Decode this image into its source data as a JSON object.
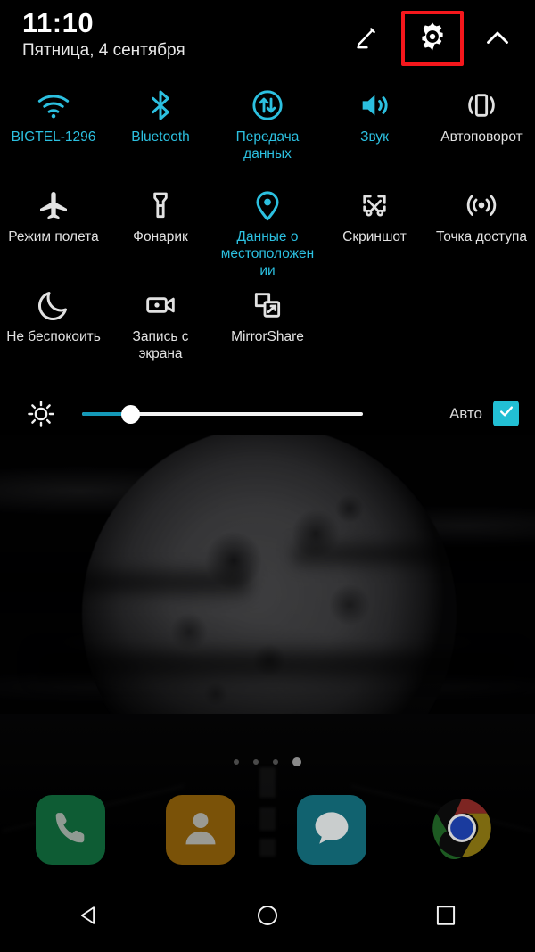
{
  "statusbar": {
    "time": "11:10",
    "date": "Пятница, 4 сентября"
  },
  "header": {
    "edit_icon": "pencil-icon",
    "settings_icon": "gear-icon",
    "collapse_icon": "chevron-up-icon",
    "highlight_color": "#f5171c",
    "highlight_target": "settings-button"
  },
  "colors": {
    "active": "#2cc0e0",
    "inactive": "#e2e2e2",
    "checkbox": "#22bfd4",
    "slider_fill": "#1499b8",
    "highlight": "#f5171c"
  },
  "tiles": [
    [
      {
        "label": "BIGTEL-1296",
        "icon": "wifi-icon",
        "state": "on"
      },
      {
        "label": "Bluetooth",
        "icon": "bluetooth-icon",
        "state": "on"
      },
      {
        "label": "Передача данных",
        "icon": "mobile-data-icon",
        "state": "on"
      },
      {
        "label": "Звук",
        "icon": "sound-icon",
        "state": "on"
      },
      {
        "label": "Автоповорот",
        "icon": "auto-rotate-icon",
        "state": "off"
      }
    ],
    [
      {
        "label": "Режим полета",
        "icon": "airplane-icon",
        "state": "off"
      },
      {
        "label": "Фонарик",
        "icon": "flashlight-icon",
        "state": "off"
      },
      {
        "label": "Данные о местоположении",
        "icon": "location-pin-icon",
        "state": "on"
      },
      {
        "label": "Скриншот",
        "icon": "screenshot-icon",
        "state": "off"
      },
      {
        "label": "Точка доступа",
        "icon": "hotspot-icon",
        "state": "off"
      }
    ],
    [
      {
        "label": "Не беспокоить",
        "icon": "moon-icon",
        "state": "off"
      },
      {
        "label": "Запись с экрана",
        "icon": "screen-record-icon",
        "state": "off"
      },
      {
        "label": "MirrorShare",
        "icon": "mirrorshare-icon",
        "state": "off"
      }
    ]
  ],
  "brightness": {
    "icon": "brightness-icon",
    "value_percent": 18,
    "auto_label": "Авто",
    "auto_checked": true,
    "check_icon": "check-icon"
  },
  "home": {
    "page_dots": 4,
    "active_dot_index": 3,
    "dock": [
      {
        "name": "Телефон",
        "icon": "phone-icon"
      },
      {
        "name": "Контакты",
        "icon": "contacts-icon"
      },
      {
        "name": "Сообщения",
        "icon": "messages-icon"
      },
      {
        "name": "Chrome",
        "icon": "chrome-icon"
      }
    ]
  },
  "navbar": [
    {
      "name": "Назад",
      "icon": "back-triangle-icon"
    },
    {
      "name": "Главный экран",
      "icon": "home-circle-icon"
    },
    {
      "name": "Обзор",
      "icon": "recents-square-icon"
    }
  ]
}
